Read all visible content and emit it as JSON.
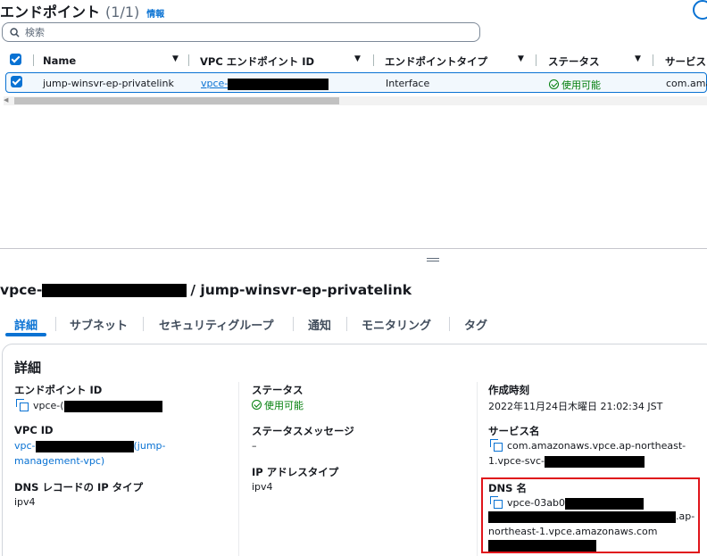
{
  "header": {
    "title": "エンドポイント",
    "count": "(1/1)",
    "info": "情報"
  },
  "search": {
    "placeholder": "検索"
  },
  "table": {
    "columns": [
      "Name",
      "VPC エンドポイント ID",
      "エンドポイントタイプ",
      "ステータス",
      "サービス"
    ],
    "row": {
      "name": "jump-winsvr-ep-privatelink",
      "endpoint_id_prefix": "vpce-",
      "type": "Interface",
      "status": "使用可能",
      "service": "com.ama"
    }
  },
  "detail": {
    "title_prefix": "vpce-",
    "title_suffix": "/ jump-winsvr-ep-privatelink",
    "tabs": [
      "詳細",
      "サブネット",
      "セキュリティグループ",
      "通知",
      "モニタリング",
      "タグ"
    ],
    "active_tab": "詳細",
    "section_title": "詳細",
    "endpoint_id": {
      "label": "エンドポイント ID",
      "value_prefix": "vpce-("
    },
    "vpc_id": {
      "label": "VPC ID",
      "value_prefix": "vpc-",
      "value_suffix": "(jump-",
      "value_line2": "management-vpc)"
    },
    "dns_ip_type": {
      "label": "DNS レコードの IP タイプ",
      "value": "ipv4"
    },
    "status": {
      "label": "ステータス",
      "value": "使用可能"
    },
    "status_message": {
      "label": "ステータスメッセージ",
      "value": "–"
    },
    "ip_address_type": {
      "label": "IP アドレスタイプ",
      "value": "ipv4"
    },
    "created": {
      "label": "作成時刻",
      "value": "2022年11月24日木曜日 21:02:34 JST"
    },
    "service_name": {
      "label": "サービス名",
      "line1": "com.amazonaws.vpce.ap-northeast-",
      "line2": "1.vpce-svc-"
    },
    "dns_name": {
      "label": "DNS 名",
      "line1": "vpce-03ab0",
      "line2_suffix": ".ap-",
      "line3": "northeast-1.vpce.amazonaws.com"
    }
  },
  "colors": {
    "accent": "#0972d3",
    "success": "#037f0c",
    "highlight": "#e0151b"
  }
}
